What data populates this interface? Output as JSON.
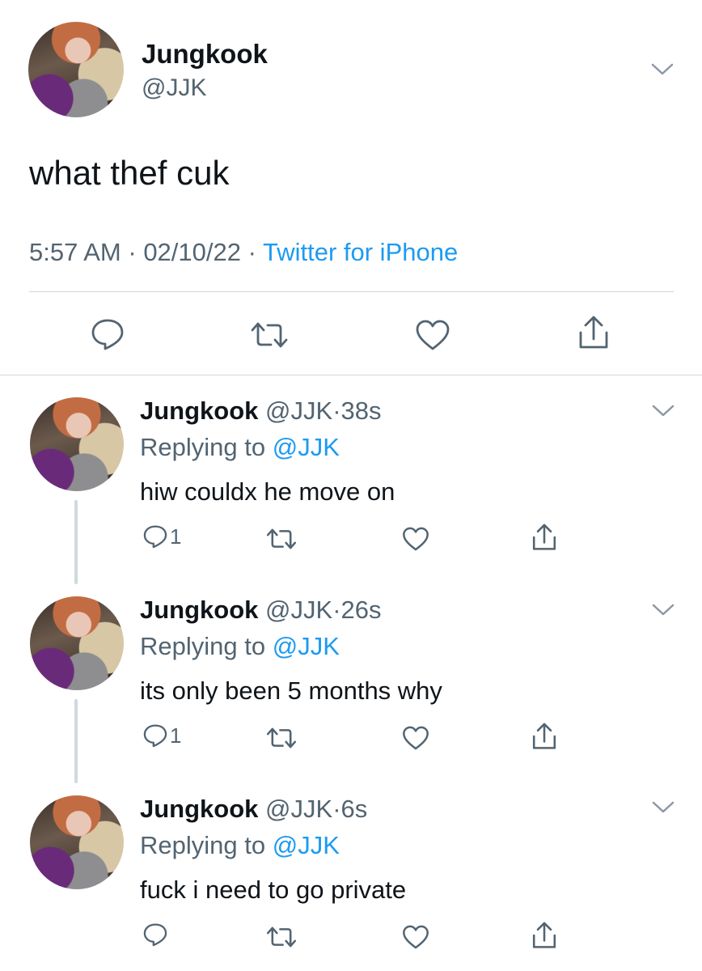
{
  "main_tweet": {
    "author_name": "Jungkook",
    "handle": "@JJK",
    "text": "what thef cuk",
    "time": "5:57 AM",
    "sep1": " · ",
    "date": "02/10/22",
    "sep2": " · ",
    "source": "Twitter for iPhone",
    "icons": [
      "reply-icon",
      "retweet-icon",
      "like-icon",
      "share-icon"
    ]
  },
  "replies": [
    {
      "author_name": "Jungkook",
      "handle": "@JJK",
      "dot": "·",
      "time": "38s",
      "replying_prefix": "Replying to ",
      "replying_to": "@JJK",
      "text": "hiw couldx he move on",
      "reply_count": "1"
    },
    {
      "author_name": "Jungkook",
      "handle": "@JJK",
      "dot": "·",
      "time": "26s",
      "replying_prefix": "Replying to ",
      "replying_to": "@JJK",
      "text": "its only been 5 months why",
      "reply_count": "1"
    },
    {
      "author_name": "Jungkook",
      "handle": "@JJK",
      "dot": "·",
      "time": "6s",
      "replying_prefix": "Replying to ",
      "replying_to": "@JJK",
      "text": "fuck i need to go private",
      "reply_count": ""
    }
  ],
  "colors": {
    "text_primary": "#0f1419",
    "text_secondary": "#536471",
    "link": "#1d9bf0",
    "divider": "#cfd9de"
  }
}
